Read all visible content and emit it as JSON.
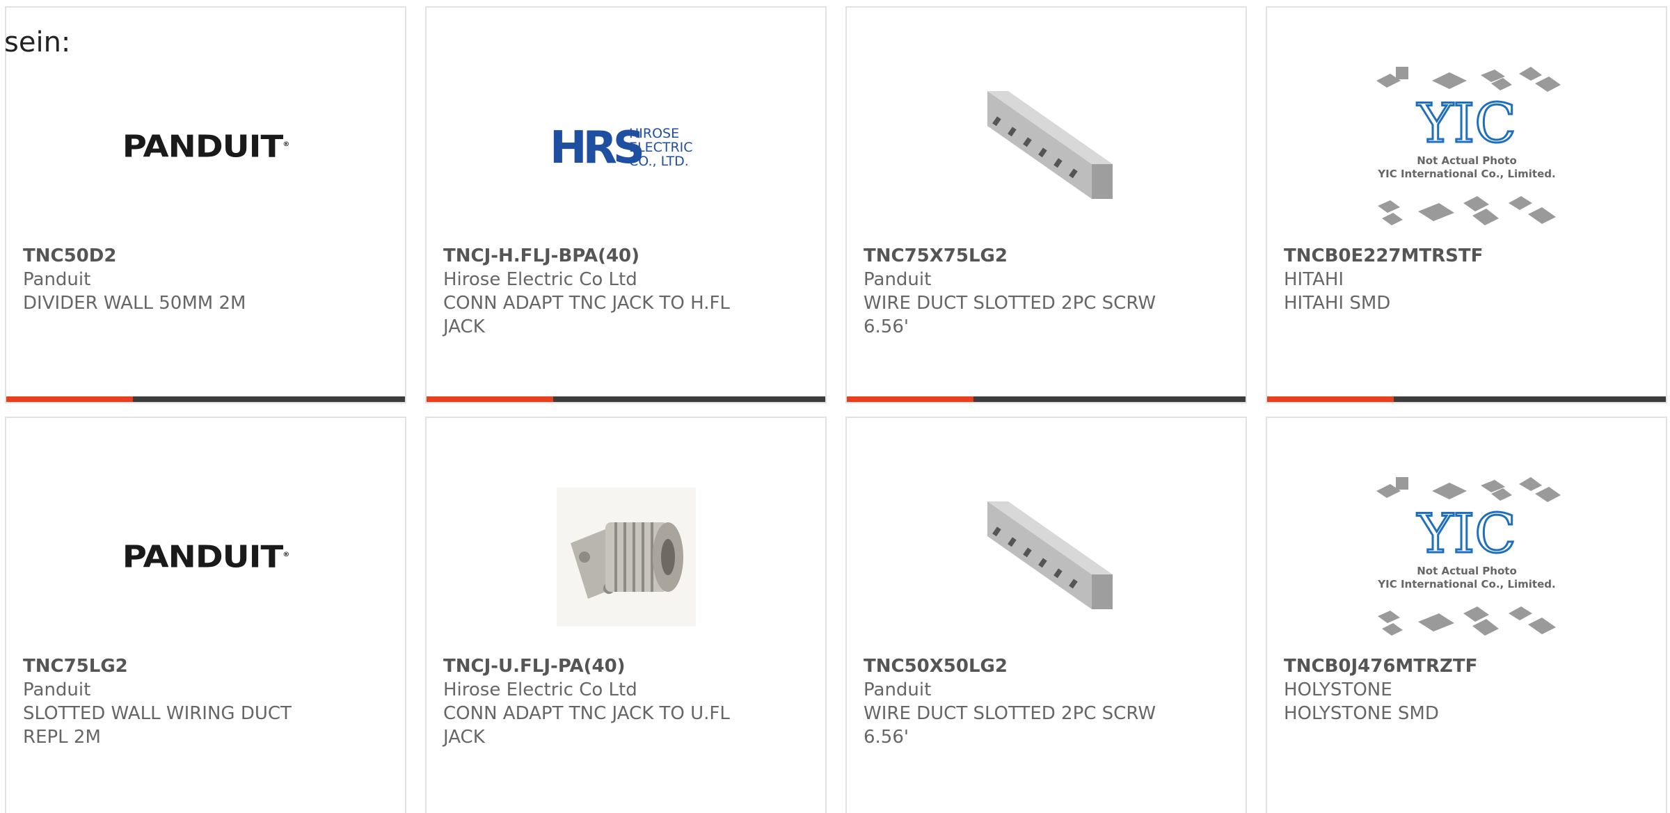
{
  "leftover_text": "sein:",
  "cards": [
    {
      "part": "TNC50D2",
      "manufacturer": "Panduit",
      "description": "DIVIDER WALL 50MM 2M",
      "image": "panduit-logo"
    },
    {
      "part": "TNCJ-H.FLJ-BPA(40)",
      "manufacturer": "Hirose Electric Co Ltd",
      "description": "CONN ADAPT TNC JACK TO H.FL JACK",
      "image": "hirose-logo"
    },
    {
      "part": "TNC75X75LG2",
      "manufacturer": "Panduit",
      "description": "WIRE DUCT SLOTTED 2PC SCRW 6.56'",
      "image": "wire-duct"
    },
    {
      "part": "TNCB0E227MTRSTF",
      "manufacturer": "HITAHI",
      "description": "HITAHI SMD",
      "image": "yic-placeholder"
    },
    {
      "part": "TNC75LG2",
      "manufacturer": "Panduit",
      "description": "SLOTTED WALL WIRING DUCT REPL 2M",
      "image": "panduit-logo"
    },
    {
      "part": "TNCJ-U.FLJ-PA(40)",
      "manufacturer": "Hirose Electric Co Ltd",
      "description": "CONN ADAPT TNC JACK TO U.FL JACK",
      "image": "tnc-connector"
    },
    {
      "part": "TNC50X50LG2",
      "manufacturer": "Panduit",
      "description": "WIRE DUCT SLOTTED 2PC SCRW 6.56'",
      "image": "wire-duct"
    },
    {
      "part": "TNCB0J476MTRZTF",
      "manufacturer": "HOLYSTONE",
      "description": "HOLYSTONE SMD",
      "image": "yic-placeholder"
    }
  ],
  "logos": {
    "panduit": "PANDUIT",
    "hirose_mark": "HRS",
    "hirose_lines": [
      "HIROSE",
      "ELECTRIC",
      "CO., LTD."
    ]
  },
  "yic_placeholder": {
    "mark": "YIC",
    "line1": "Not Actual Photo",
    "line2": "YIC International Co., Limited."
  },
  "colors": {
    "accent": "#e8401c",
    "bar": "#3d3d3d",
    "hirose_blue": "#1f4fa0",
    "yic_blue": "#1f6fc0"
  }
}
